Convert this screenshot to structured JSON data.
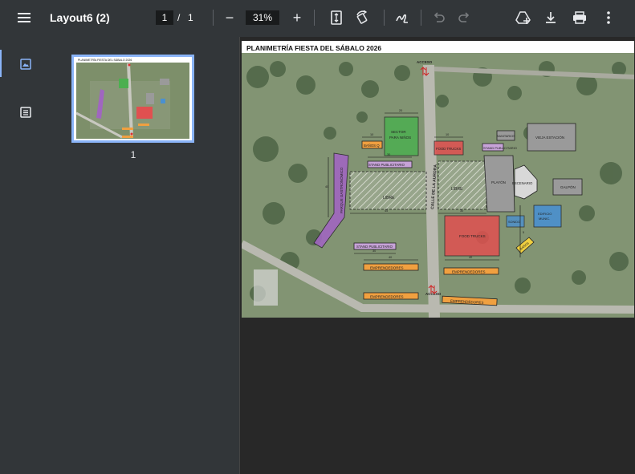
{
  "app": {
    "menu_icon": "hamburger-icon"
  },
  "document": {
    "title": "Layout6 (2)"
  },
  "pager": {
    "current": "1",
    "separator": "/",
    "total": "1"
  },
  "zoom": {
    "minus": "−",
    "value": "31%",
    "plus": "+"
  },
  "toolbar_icons": [
    "fit-page-icon",
    "rotate-icon",
    "annotate-icon",
    "undo-icon",
    "redo-icon",
    "drive-add-icon",
    "download-icon",
    "print-icon",
    "more-vert-icon"
  ],
  "sidebar": {
    "rail": [
      "thumbnails-icon",
      "outline-icon"
    ],
    "thumbnails": [
      {
        "page": "1",
        "selected": true
      }
    ]
  },
  "plan": {
    "title": "PLANIMETRÍA FIESTA DEL SÁBALO 2026",
    "labels": {
      "acceso_top": "ACCESO",
      "acceso_bottom": "ACCESO",
      "sector_ninos_1": "SECTOR",
      "sector_ninos_2": "PARA NIÑOS",
      "banos": "BAÑOS Q",
      "stand_publicitario_1": "STAND PUBLICITARIO",
      "stand_publicitario_2": "STAND PUBLICITARIO",
      "stand_publicitario_3": "STAND PUBLICITARIO",
      "libre_1": "LIBRE",
      "libre_2": "LIBRE",
      "parque_gastronomico": "PARQUE GASTRONÓMICO",
      "calle": "CALLE DE LA AURORA",
      "food_trucks_1": "FOOD TRUCKS",
      "food_trucks_2": "FOOD TRUCKS",
      "sanitarios": "SANITARIOS",
      "platon": "PLAYÓN",
      "escenario": "ESCENARIO",
      "vieja_estacion": "VIEJA ESTACIÓN",
      "galpon": "GALPÓN",
      "sonido": "SONIDO",
      "edificio_municipal_1": "EDIFICIO",
      "edificio_municipal_2": "MUNIC.",
      "emprendedores_1": "EMPRENDEDORES",
      "emprendedores_2": "EMPRENDEDORES",
      "emprendedores_3": "EMPRENDEDORES",
      "emprendedores_4": "EMPRENDEDORES",
      "baños_diag": "BAÑOS",
      "dim_5": "5",
      "dim_10": "10",
      "dim_20": "20",
      "dim_30": "30",
      "dim_40": "40",
      "dim_45": "45"
    }
  },
  "colors": {
    "toolbar": "#323639",
    "accent": "#8ab4f8",
    "green_zone": "#4caf50",
    "red_zone": "#e05050",
    "purple_zone": "#a066c0",
    "orange_zone": "#f0a040",
    "blue_zone": "#4a90d0",
    "gray_zone": "#9a9a9a"
  }
}
